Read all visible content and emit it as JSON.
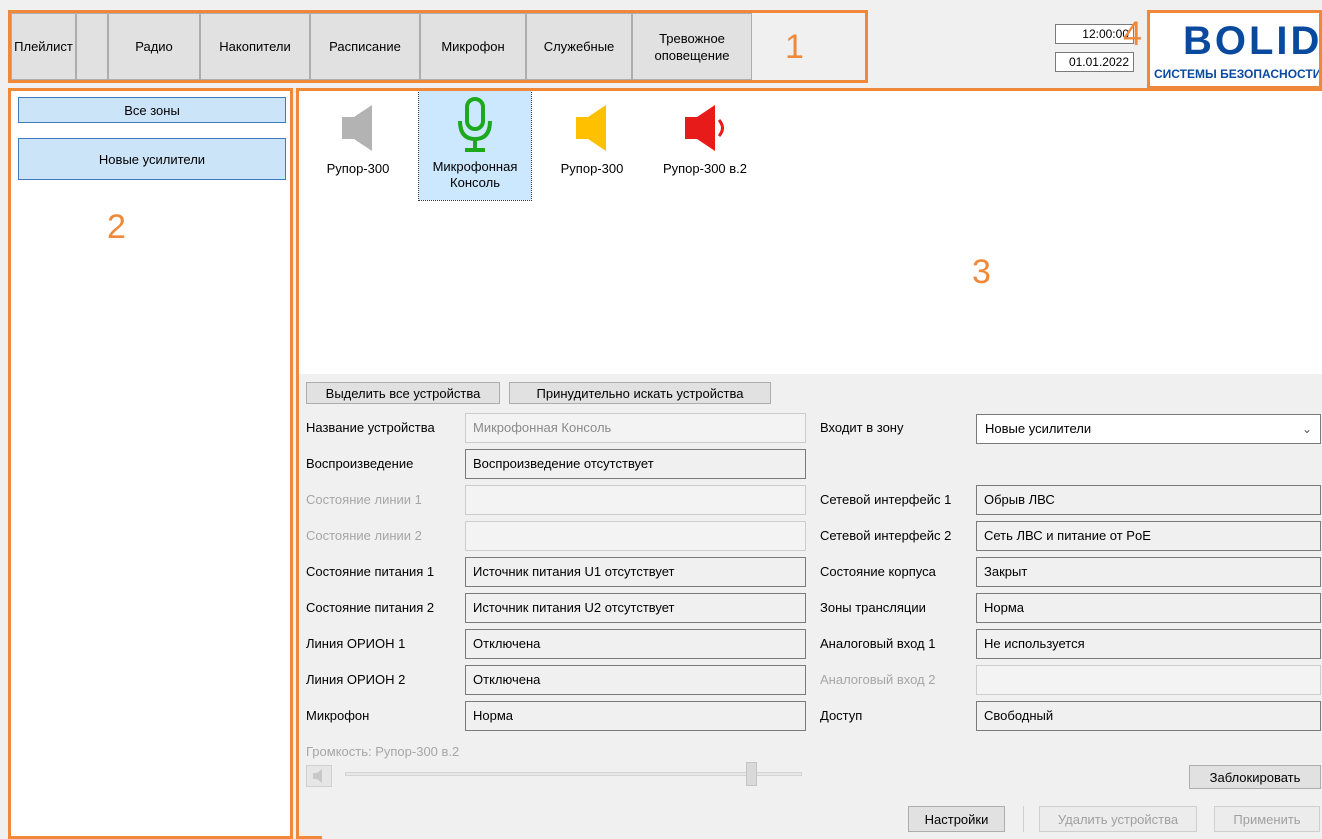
{
  "tabs": [
    {
      "label": "Плейлист"
    },
    {
      "label": "Радио"
    },
    {
      "label": "Накопители"
    },
    {
      "label": "Расписание"
    },
    {
      "label": "Микрофон"
    },
    {
      "label": "Служебные"
    },
    {
      "label": "Тревожное оповещение"
    }
  ],
  "clock": {
    "time": "12:00:00",
    "date": "01.01.2022"
  },
  "logo": {
    "word": "BOLID",
    "subtitle": "СИСТЕМЫ БЕЗОПАСНОСТИ"
  },
  "annotations": {
    "n1": "1",
    "n2": "2",
    "n3": "3",
    "n4": "4"
  },
  "zones": [
    {
      "label": "Все зоны"
    },
    {
      "label": "Новые усилители",
      "selected": true
    }
  ],
  "devices": [
    {
      "label": "Рупор-300",
      "icon": "speaker-icon",
      "color": "#b3b3b3"
    },
    {
      "label": "Микрофонная Консоль",
      "icon": "microphone-icon",
      "color": "#1ea81e",
      "selected": true
    },
    {
      "label": "Рупор-300",
      "icon": "speaker-icon",
      "color": "#ffc000"
    },
    {
      "label": "Рупор-300 в.2",
      "icon": "speaker-icon",
      "color": "#e81b1b"
    }
  ],
  "actions": {
    "select_all": "Выделить все устройства",
    "force_search": "Принудительно искать устройства"
  },
  "fields_left": [
    {
      "label": "Название устройства",
      "value": "Микрофонная Консоль",
      "disabled": false,
      "value_disabled": true
    },
    {
      "label": "Воспроизведение",
      "value": "Воспроизведение отсутствует",
      "disabled": false
    },
    {
      "label": "Состояние линии 1",
      "value": "",
      "disabled": true
    },
    {
      "label": "Состояние линии 2",
      "value": "",
      "disabled": true
    },
    {
      "label": "Состояние питания 1",
      "value": "Источник питания U1 отсутствует",
      "disabled": false
    },
    {
      "label": "Состояние питания 2",
      "value": "Источник питания U2 отсутствует",
      "disabled": false
    },
    {
      "label": "Линия ОРИОН 1",
      "value": "Отключена",
      "disabled": false
    },
    {
      "label": "Линия ОРИОН 2",
      "value": "Отключена",
      "disabled": false
    },
    {
      "label": "Микрофон",
      "value": "Норма",
      "disabled": false
    }
  ],
  "zone_select": {
    "label": "Входит в зону",
    "value": "Новые усилители"
  },
  "fields_right": [
    {
      "label": "Сетевой интерфейс 1",
      "value": "Обрыв ЛВС",
      "disabled": false
    },
    {
      "label": "Сетевой интерфейс 2",
      "value": "Сеть ЛВС и питание от PoE",
      "disabled": false
    },
    {
      "label": "Состояние корпуса",
      "value": "Закрыт",
      "disabled": false
    },
    {
      "label": "Зоны трансляции",
      "value": "Норма",
      "disabled": false
    },
    {
      "label": "Аналоговый вход 1",
      "value": "Не используется",
      "disabled": false
    },
    {
      "label": "Аналоговый вход 2",
      "value": "",
      "disabled": true
    },
    {
      "label": "Доступ",
      "value": "Свободный",
      "disabled": false
    }
  ],
  "volume": {
    "label": "Громкость: Рупор-300 в.2",
    "level": 0.9,
    "disabled": true
  },
  "buttons": {
    "lock": "Заблокировать",
    "settings": "Настройки",
    "delete": "Удалить устройства",
    "apply": "Применить"
  }
}
